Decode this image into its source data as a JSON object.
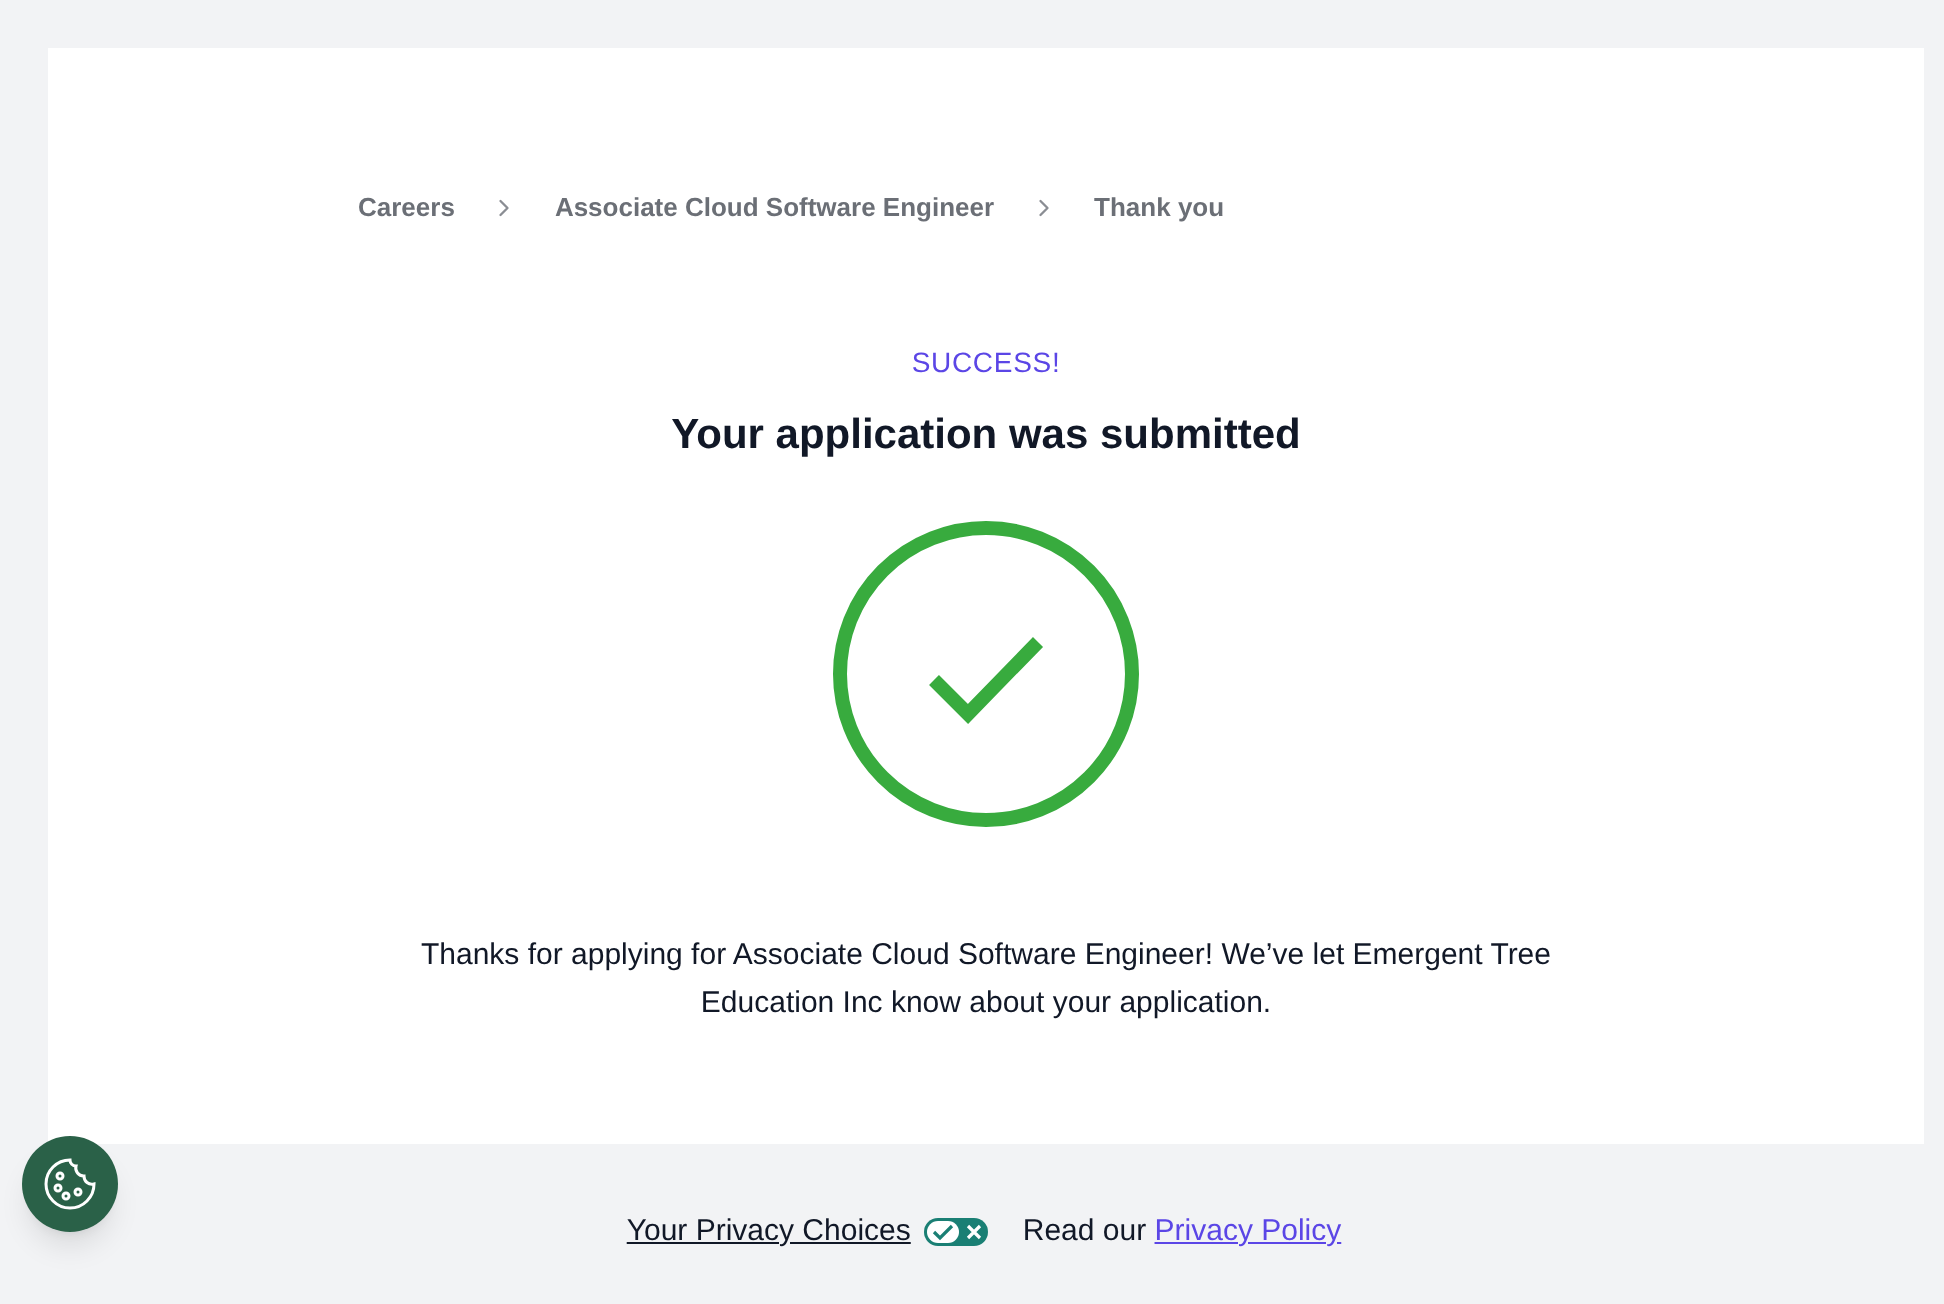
{
  "breadcrumb": [
    {
      "label": "Careers"
    },
    {
      "label": "Associate Cloud Software Engineer"
    },
    {
      "label": "Thank you"
    }
  ],
  "status": "SUCCESS!",
  "title": "Your application was submitted",
  "message": "Thanks for applying for Associate Cloud Software Engineer! We’ve let Emergent Tree Education Inc know about your application.",
  "footer": {
    "privacy_choices": "Your Privacy Choices",
    "policy_prefix": "Read our",
    "policy_link": "Privacy Policy"
  }
}
